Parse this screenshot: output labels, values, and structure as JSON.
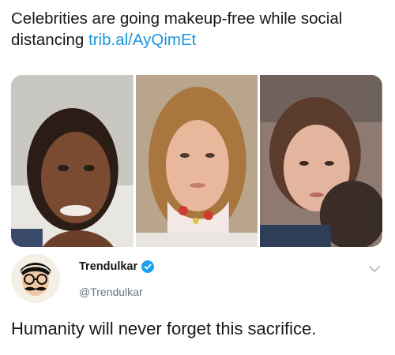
{
  "post": {
    "headline_text": "Celebrities are going makeup-free while social distancing ",
    "headline_link": "trib.al/AyQimEt"
  },
  "images": [
    {
      "icon": "portrait-photo-1"
    },
    {
      "icon": "portrait-photo-2"
    },
    {
      "icon": "portrait-photo-3"
    }
  ],
  "tweet": {
    "display_name": "Trendulkar",
    "handle": "@Trendulkar",
    "text": "Humanity will never forget this sacrifice."
  },
  "colors": {
    "link": "#1b95e0",
    "verified": "#1da1f2",
    "handle": "#657786",
    "text": "#16181b"
  },
  "icons": {
    "verified": "verified-badge-icon",
    "menu": "chevron-down-icon",
    "avatar": "avatar-cartoon"
  }
}
